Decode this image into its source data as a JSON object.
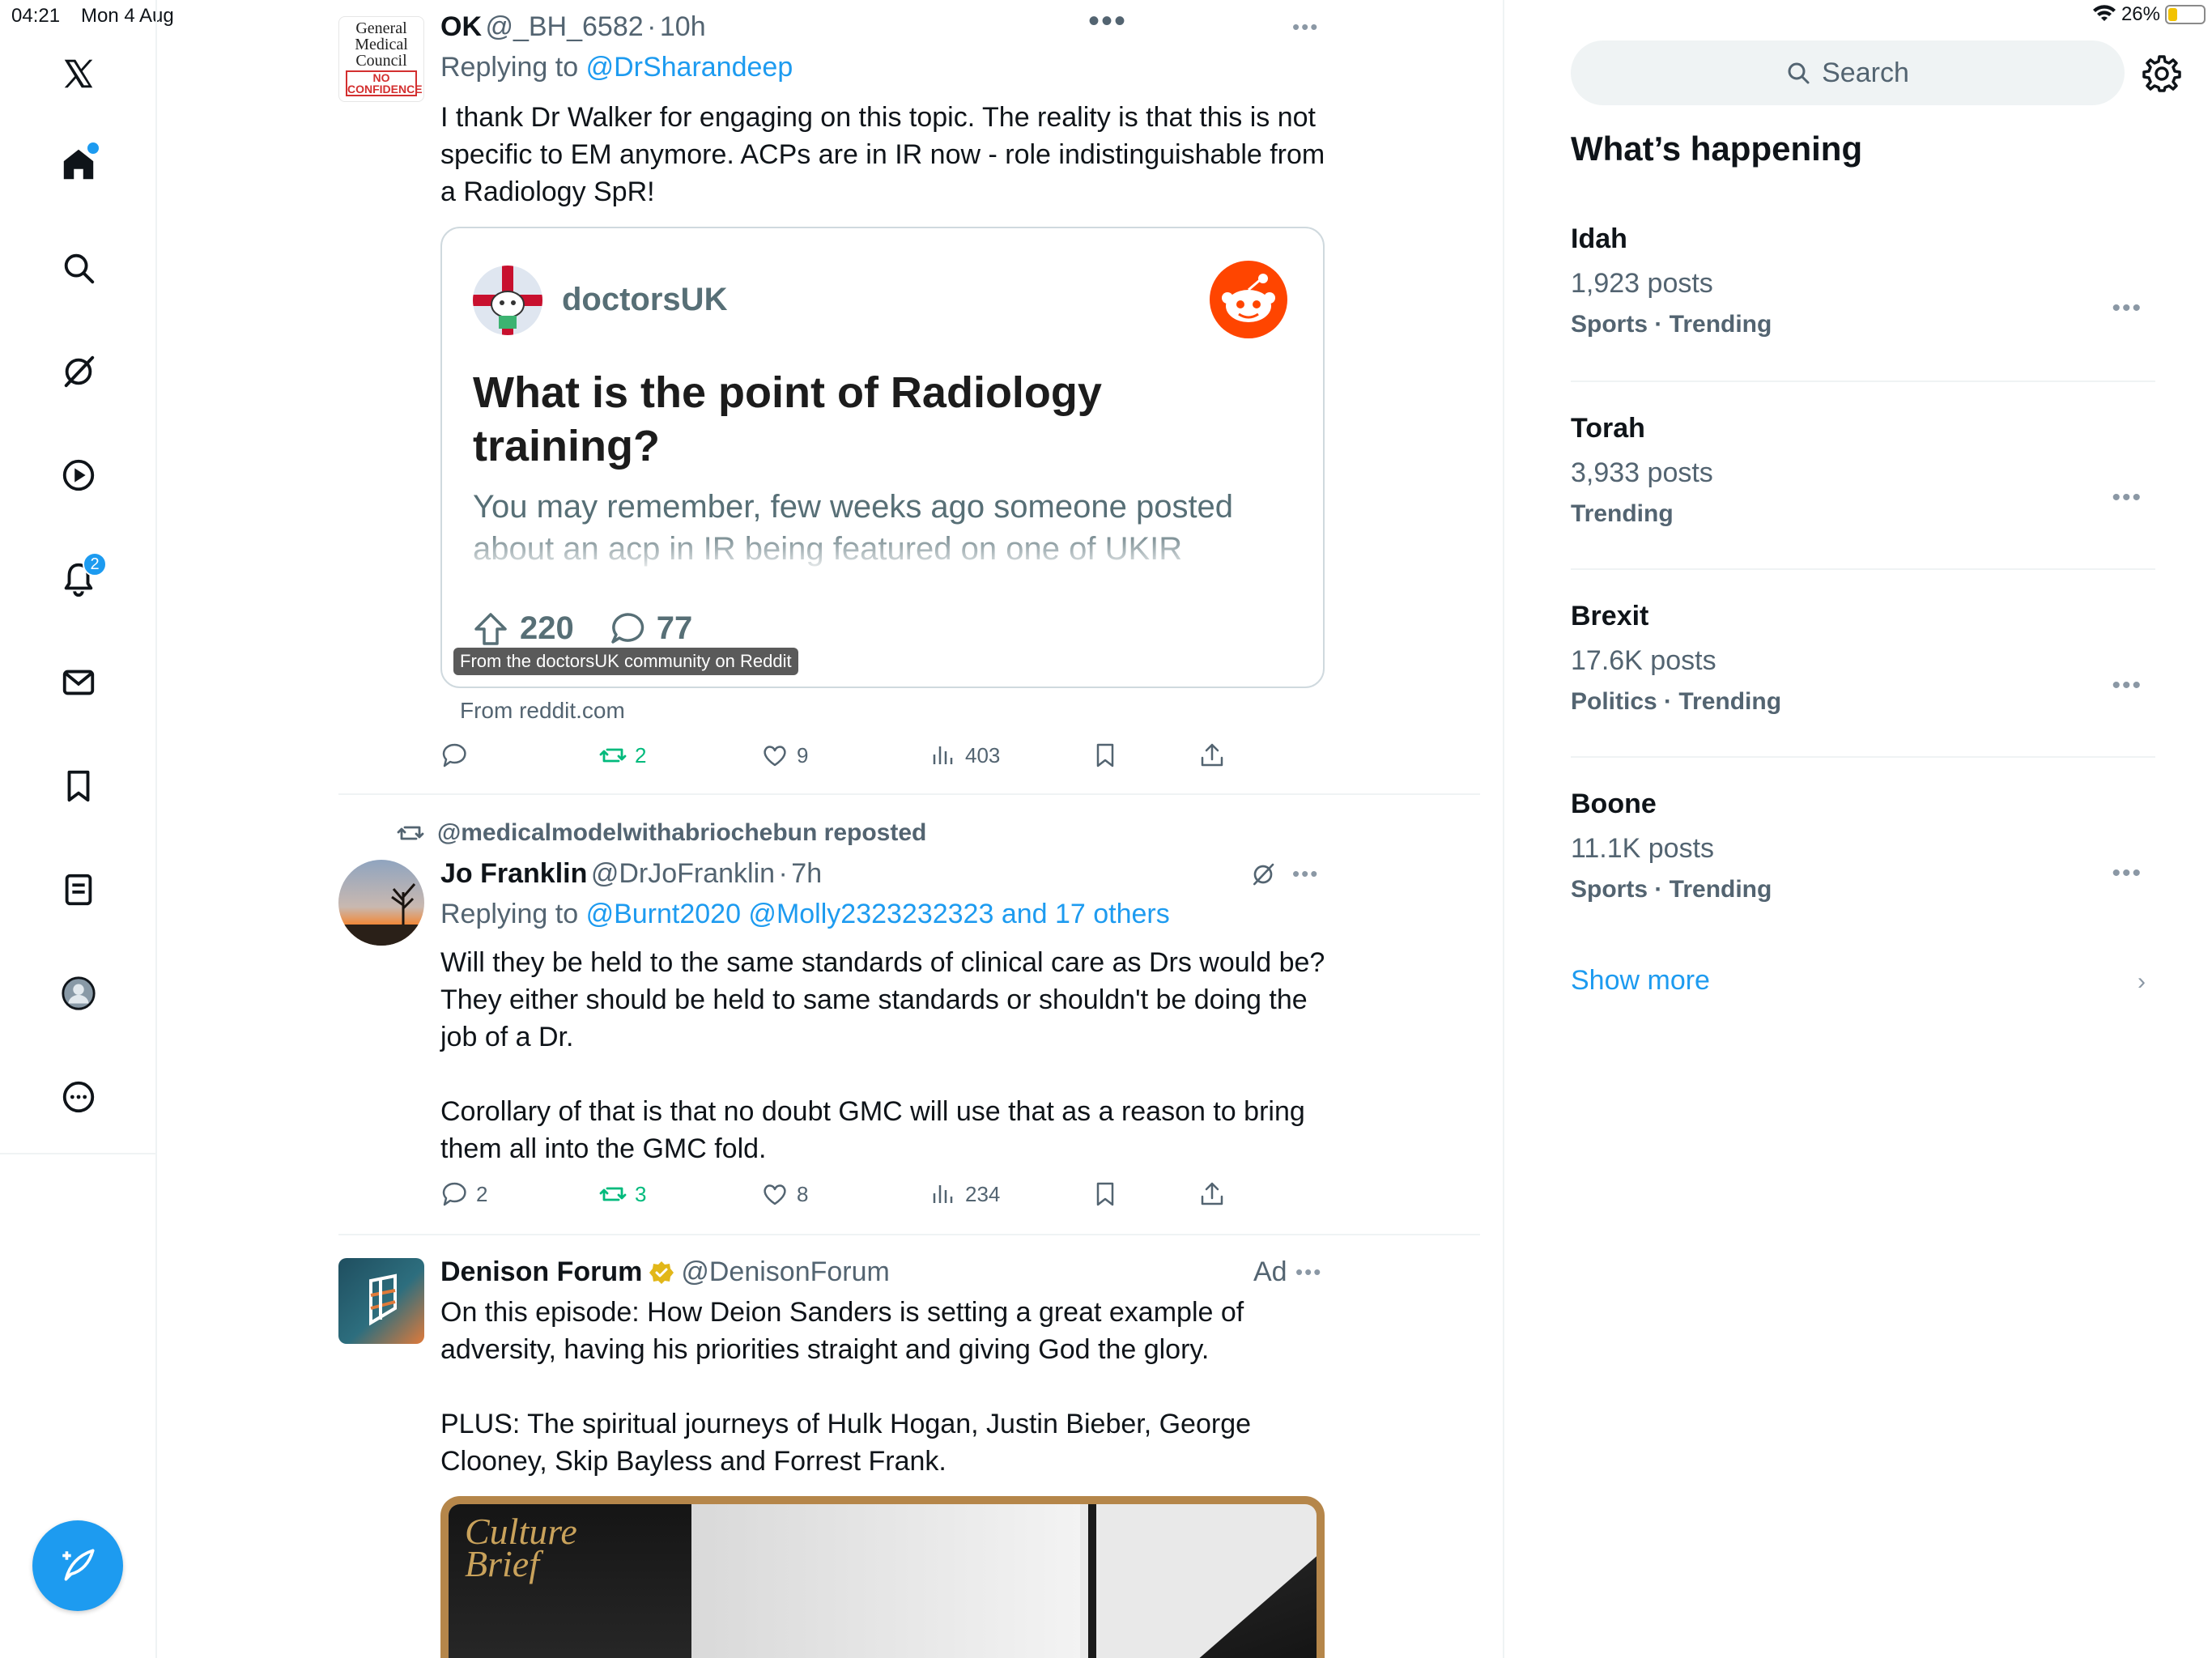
{
  "status_bar": {
    "time": "04:21",
    "date": "Mon 4 Aug",
    "battery_pct": "26%",
    "battery_level": 0.26
  },
  "nav": {
    "notification_count": "2"
  },
  "tweets": [
    {
      "name": "OK",
      "handle": "@_BH_6582",
      "time": "10h",
      "avatar_text": [
        "General",
        "Medical",
        "Council",
        "NO",
        "CONFIDENCE"
      ],
      "reply_prefix": "Replying to",
      "reply_to": "@DrSharandeep",
      "text": "I thank Dr Walker for engaging on this topic. The reality is that this is not specific to EM anymore. ACPs are in IR now - role indistinguishable from a Radiology SpR!",
      "card": {
        "subreddit": "doctorsUK",
        "title": "What is the point of Radiology training?",
        "body": "You may remember, few weeks ago someone posted about an acp in IR being featured on one of UKIR",
        "upvotes": "220",
        "comments": "77",
        "overlay": "From the doctorsUK community on Reddit",
        "source": "From reddit.com"
      },
      "actions": {
        "replies": "",
        "reposts": "2",
        "likes": "9",
        "views": "403"
      }
    },
    {
      "reposted_by": "@medicalmodelwithabriochebun reposted",
      "name": "Jo Franklin",
      "handle": "@DrJoFranklin",
      "time": "7h",
      "reply_prefix": "Replying to",
      "reply_to": "@Burnt2020 @Molly2323232323 and 17 others",
      "text": "Will they be held to the same standards of clinical care as Drs would be? They either should be held to same standards or shouldn't be doing the job of a Dr.\n\nCorollary of that is that no doubt GMC will use that as a reason to bring them all into the GMC fold.",
      "actions": {
        "replies": "2",
        "reposts": "3",
        "likes": "8",
        "views": "234"
      }
    },
    {
      "name": "Denison Forum",
      "handle": "@DenisonForum",
      "ad_label": "Ad",
      "text": "On this episode: How Deion Sanders is setting a great example of adversity, having his priorities straight and giving God the glory.\n\nPLUS: The spiritual journeys of Hulk Hogan, Justin Bieber, George Clooney, Skip Bayless and Forrest Frank.",
      "media_text": "Culture Brief"
    }
  ],
  "sidebar": {
    "search_placeholder": "Search",
    "section_title": "What’s happening",
    "trends": [
      {
        "name": "Idah",
        "count": "1,923 posts",
        "meta": "Sports · Trending"
      },
      {
        "name": "Torah",
        "count": "3,933 posts",
        "meta": "Trending"
      },
      {
        "name": "Brexit",
        "count": "17.6K posts",
        "meta": "Politics · Trending"
      },
      {
        "name": "Boone",
        "count": "11.1K posts",
        "meta": "Sports · Trending"
      }
    ],
    "show_more": "Show more"
  },
  "colors": {
    "accent": "#1d9bf0",
    "repost_green": "#00ba7c",
    "reddit_orange": "#ff4500",
    "muted_text": "#536471"
  }
}
